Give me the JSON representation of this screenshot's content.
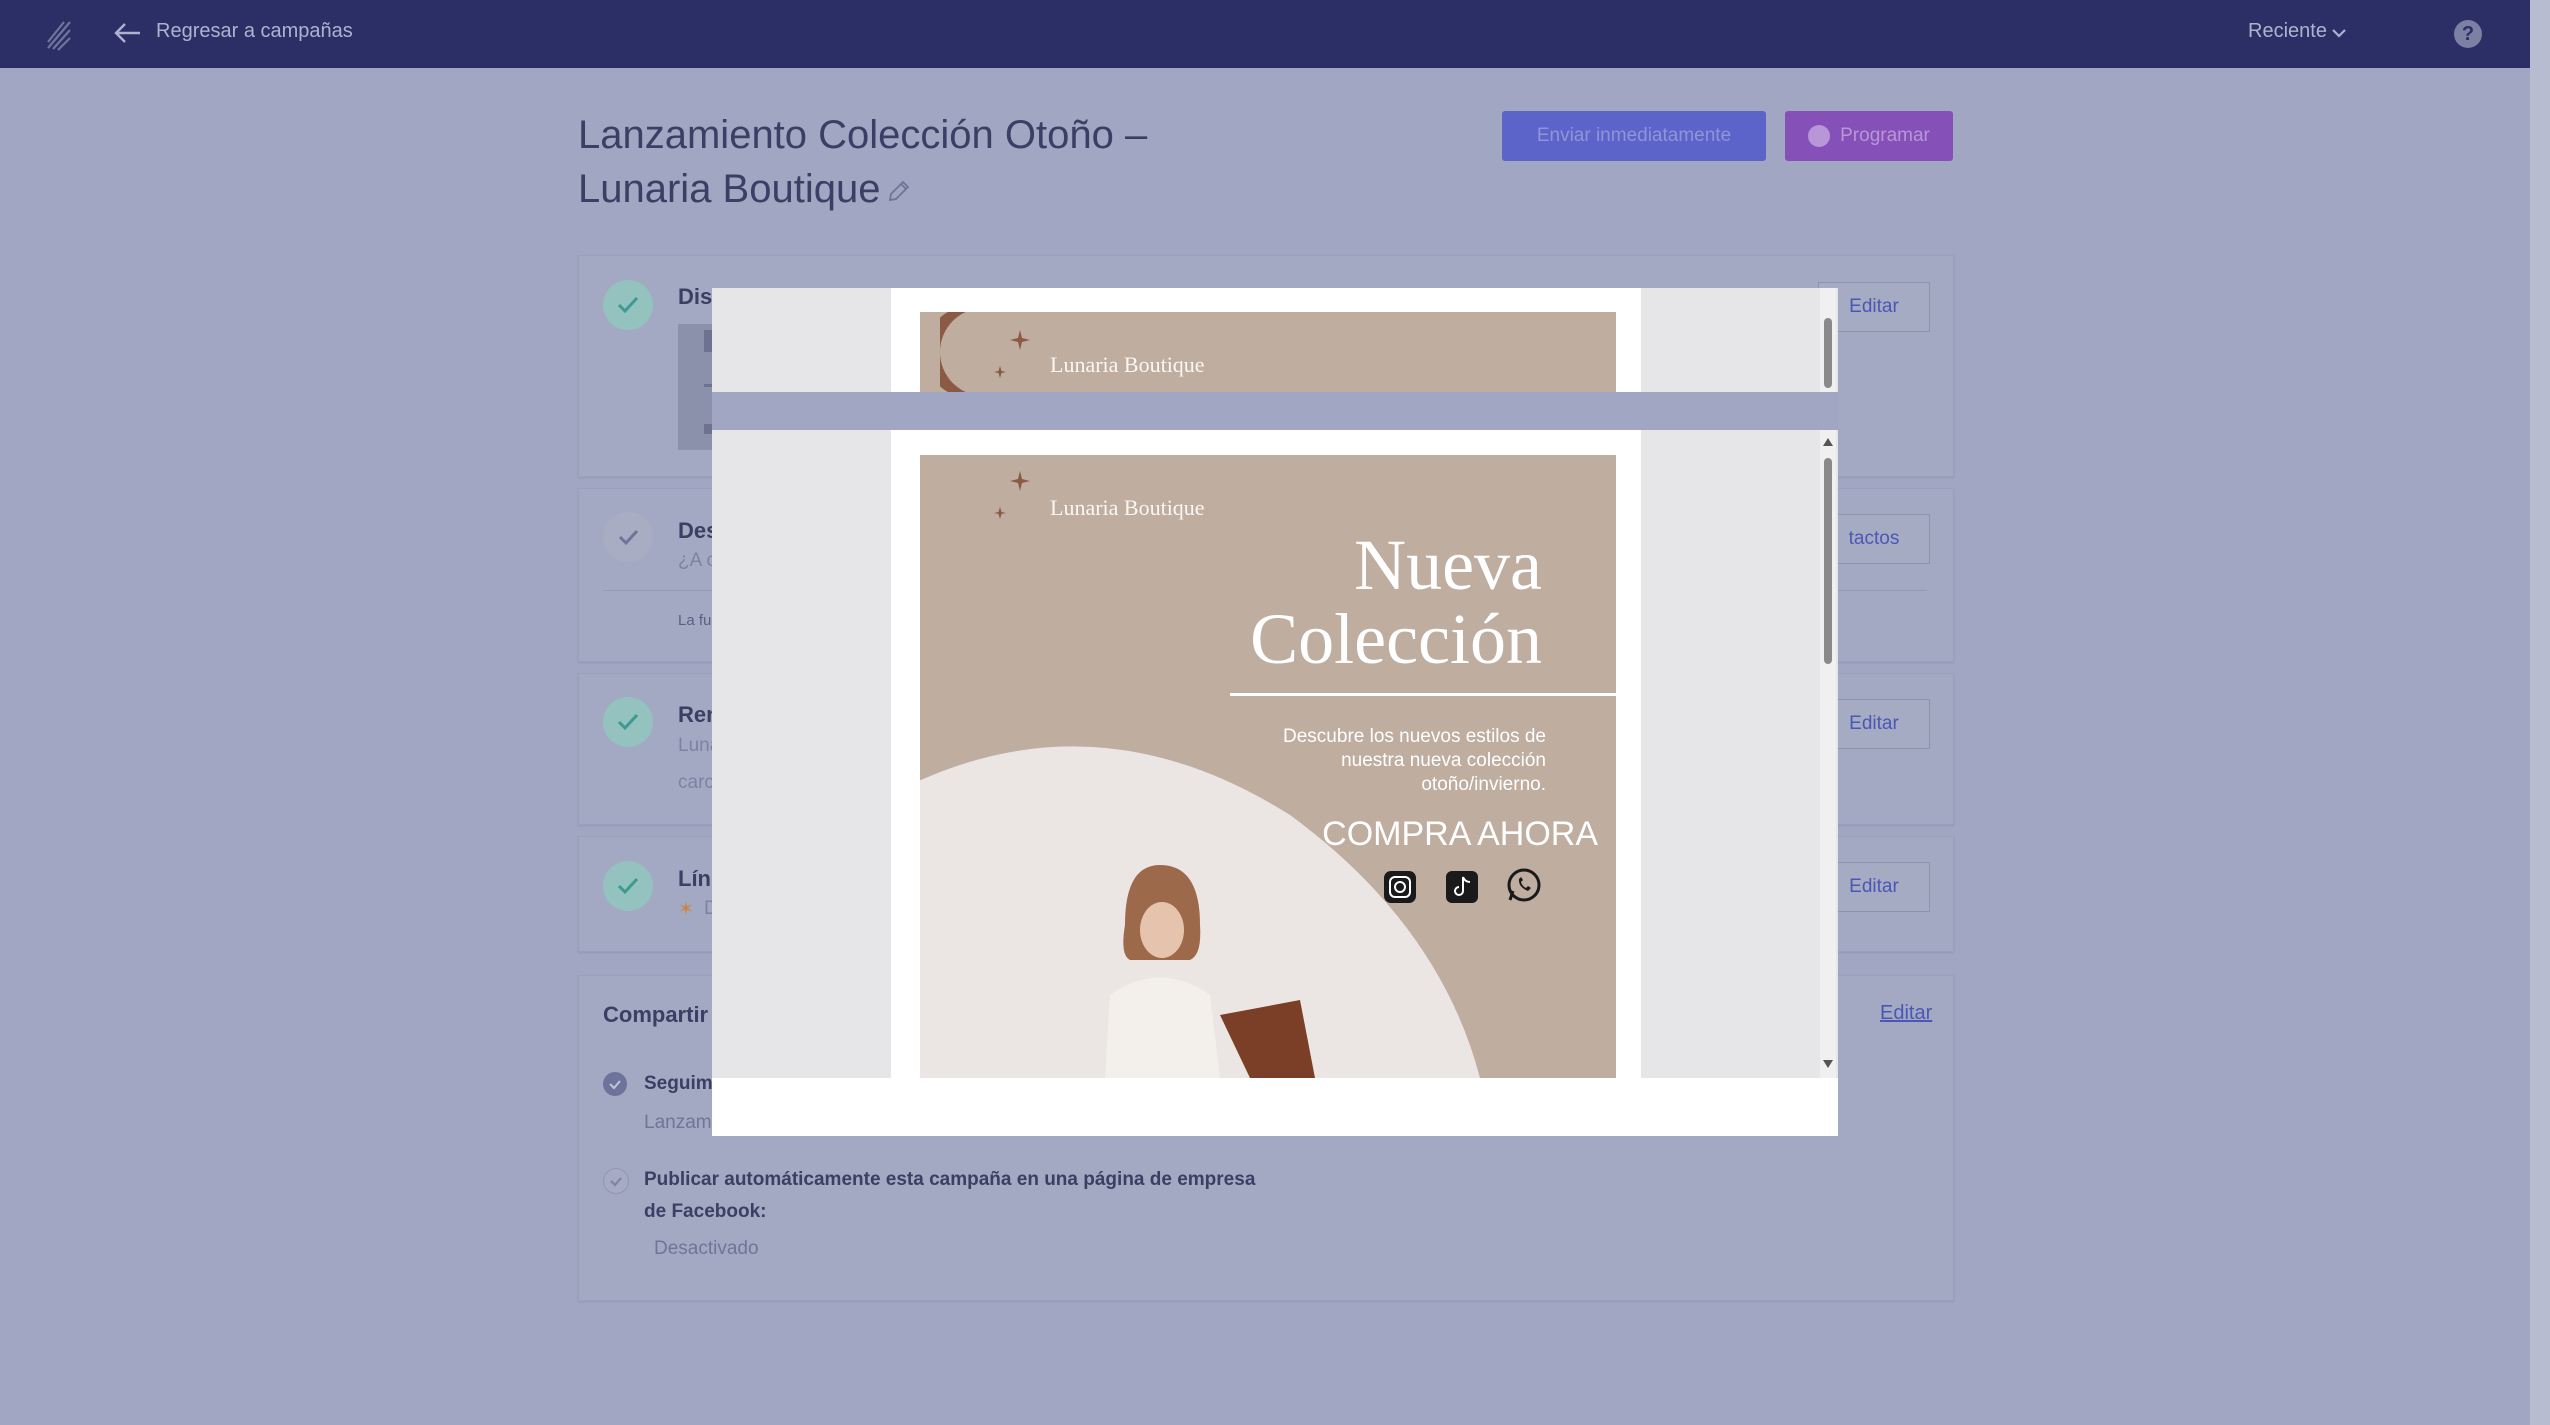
{
  "topbar": {
    "back_label": "Regresar a campañas",
    "recent_label": "Reciente",
    "help_label": "?"
  },
  "campaign": {
    "title_line1": "Lanzamiento Colección Otoño –",
    "title_line2": "Lunaria Boutique"
  },
  "actions": {
    "send_now": "Enviar inmediatamente",
    "schedule": "Programar"
  },
  "sections": {
    "design": {
      "title_fragment": "Dis",
      "edit_label": "Editar"
    },
    "recipients": {
      "title_fragment": "Des",
      "subtitle_fragment": "¿A c",
      "note_fragment": "La fu",
      "edit_label": "tactos"
    },
    "sender": {
      "title_fragment": "Ren",
      "line1_fragment": "Luna",
      "line2_fragment": "carc",
      "edit_label": "Editar"
    },
    "subject": {
      "title_fragment": "Lín",
      "line_fragment": "D",
      "edit_label": "Editar"
    }
  },
  "share": {
    "title_fragment": "Compartir y",
    "edit_link": "Editar",
    "tracking_label": "Seguimi",
    "tracking_value": "Lanzam",
    "facebook_label": "Publicar automáticamente esta campaña en una página de empresa de Facebook:",
    "facebook_value": "Desactivado"
  },
  "email_preview": {
    "brand": "Lunaria Boutique",
    "headline_line1": "Nueva",
    "headline_line2": "Colección",
    "description": "Descubre los nuevos estilos de nuestra nueva colección otoño/invierno.",
    "cta": "COMPRA AHORA",
    "social_icons": [
      "instagram-icon",
      "tiktok-icon",
      "whatsapp-icon"
    ]
  },
  "colors": {
    "topbar": "#2b2f66",
    "backdrop": "#a1a7c2",
    "banner": "#bfada0",
    "send_button": "#5c64c9",
    "schedule_button": "#8551b8"
  }
}
